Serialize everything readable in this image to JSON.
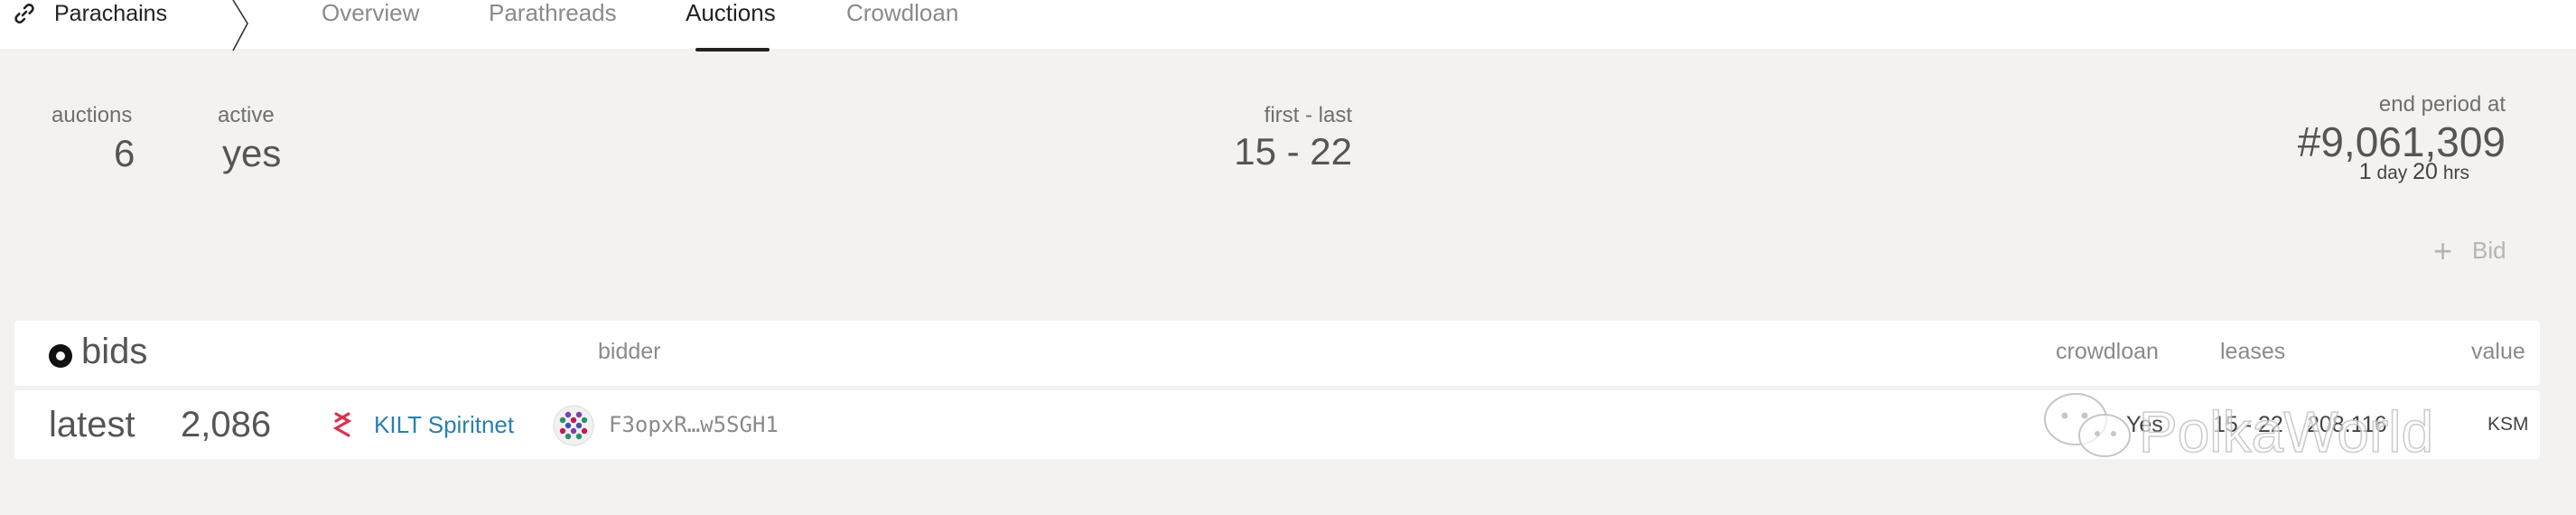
{
  "nav": {
    "brand_label": "Parachains",
    "tabs": [
      {
        "label": "Overview"
      },
      {
        "label": "Parathreads"
      },
      {
        "label": "Auctions",
        "active": true
      },
      {
        "label": "Crowdloan"
      }
    ]
  },
  "summary": {
    "auctions_label": "auctions",
    "auctions_value": "6",
    "active_label": "active",
    "active_value": "yes",
    "range_label": "first - last",
    "range_value": "15 - 22",
    "end_label": "end period at",
    "end_block": "#9,061,309",
    "end_days_num": "1",
    "end_days_unit": "day",
    "end_hrs_num": "20",
    "end_hrs_unit": "hrs"
  },
  "actions": {
    "bid_label": "Bid"
  },
  "bids_table": {
    "title": "bids",
    "columns": {
      "bidder": "bidder",
      "crowdloan": "crowdloan",
      "leases": "leases",
      "value": "value"
    },
    "rows": [
      {
        "latest": "latest",
        "block": "2,086",
        "parachain": "KILT Spiritnet",
        "bidder": "F3opxR…w5SGH1",
        "crowdloan": "Yes",
        "leases": "15 - 22",
        "value": "208.116",
        "unit": "KSM"
      }
    ]
  },
  "watermark": {
    "text": "PolkaWorld"
  },
  "colors": {
    "accent_link": "#2a7fb0",
    "background": "#f3f2f0",
    "kilt": "#d8324f"
  },
  "icons": [
    "link-icon",
    "breadcrumb-chevron-icon",
    "bids-dot-icon",
    "plus-icon",
    "kilt-logo-icon",
    "identicon-avatar",
    "wechat-icon"
  ]
}
